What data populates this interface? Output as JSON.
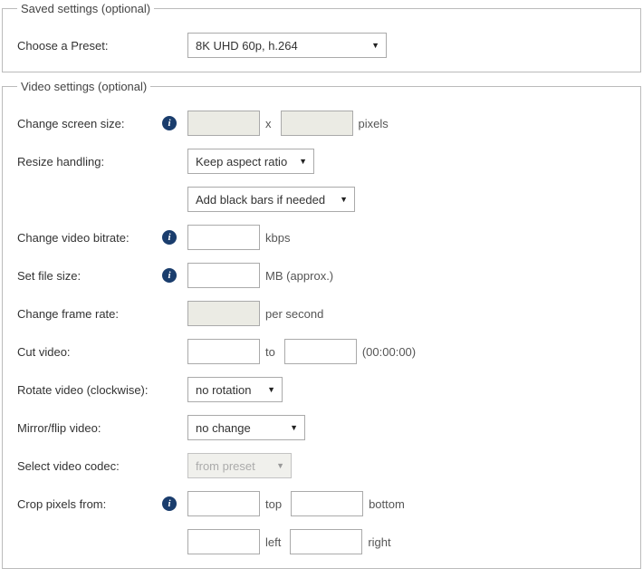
{
  "saved_settings": {
    "legend": "Saved settings (optional)",
    "preset_label": "Choose a Preset:",
    "preset_value": "8K UHD 60p, h.264"
  },
  "video_settings": {
    "legend": "Video settings (optional)",
    "screen_size": {
      "label": "Change screen size:",
      "width": "",
      "height": "",
      "separator": "x",
      "unit": "pixels"
    },
    "resize_handling": {
      "label": "Resize handling:",
      "aspect_value": "Keep aspect ratio",
      "bars_value": "Add black bars if needed"
    },
    "bitrate": {
      "label": "Change video bitrate:",
      "value": "",
      "unit": "kbps"
    },
    "filesize": {
      "label": "Set file size:",
      "value": "",
      "unit": "MB (approx.)"
    },
    "framerate": {
      "label": "Change frame rate:",
      "value": "",
      "unit": "per second"
    },
    "cut": {
      "label": "Cut video:",
      "from": "",
      "to_label": "to",
      "to": "",
      "hint": "(00:00:00)"
    },
    "rotate": {
      "label": "Rotate video (clockwise):",
      "value": "no rotation"
    },
    "mirror": {
      "label": "Mirror/flip video:",
      "value": "no change"
    },
    "codec": {
      "label": "Select video codec:",
      "value": "from preset"
    },
    "crop": {
      "label": "Crop pixels from:",
      "top": "",
      "top_label": "top",
      "bottom": "",
      "bottom_label": "bottom",
      "left": "",
      "left_label": "left",
      "right": "",
      "right_label": "right"
    }
  }
}
